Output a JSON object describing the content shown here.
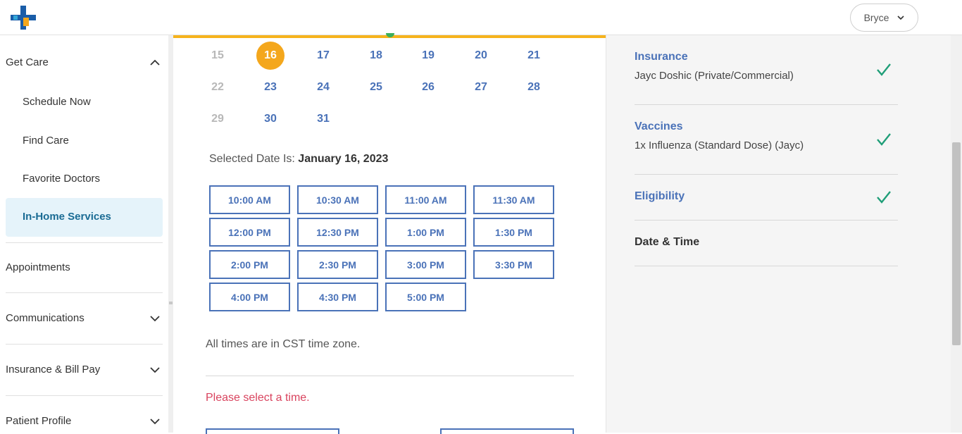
{
  "header": {
    "user_name": "Bryce",
    "icons": {
      "logo": "brand-cross-logo",
      "user_menu": "chevron-down-icon"
    }
  },
  "sidebar": {
    "get_care": "Get Care",
    "sub_items": [
      "Schedule Now",
      "Find Care",
      "Favorite Doctors"
    ],
    "active_item": "In-Home Services",
    "sections": [
      "Appointments",
      "Communications",
      "Insurance & Bill Pay",
      "Patient Profile"
    ]
  },
  "calendar": {
    "rows": [
      [
        {
          "d": "15",
          "state": "dim"
        },
        {
          "d": "16",
          "state": "selected"
        },
        {
          "d": "17",
          "state": "active"
        },
        {
          "d": "18",
          "state": "active"
        },
        {
          "d": "19",
          "state": "active"
        },
        {
          "d": "20",
          "state": "active"
        },
        {
          "d": "21",
          "state": "active"
        }
      ],
      [
        {
          "d": "22",
          "state": "dim"
        },
        {
          "d": "23",
          "state": "active"
        },
        {
          "d": "24",
          "state": "active"
        },
        {
          "d": "25",
          "state": "active"
        },
        {
          "d": "26",
          "state": "active"
        },
        {
          "d": "27",
          "state": "active"
        },
        {
          "d": "28",
          "state": "active"
        }
      ],
      [
        {
          "d": "29",
          "state": "dim"
        },
        {
          "d": "30",
          "state": "active"
        },
        {
          "d": "31",
          "state": "active"
        }
      ]
    ],
    "selected_label": "Selected Date Is:",
    "selected_value": "January 16, 2023"
  },
  "time_slots": [
    "10:00 AM",
    "10:30 AM",
    "11:00 AM",
    "11:30 AM",
    "12:00 PM",
    "12:30 PM",
    "1:00 PM",
    "1:30 PM",
    "2:00 PM",
    "2:30 PM",
    "3:00 PM",
    "3:30 PM",
    "4:00 PM",
    "4:30 PM",
    "5:00 PM"
  ],
  "timezone_note": "All times are in CST time zone.",
  "error_message": "Please select a time.",
  "summary": {
    "insurance": {
      "title": "Insurance",
      "detail": "Jayc Doshic (Private/Commercial)",
      "done": true
    },
    "vaccines": {
      "title": "Vaccines",
      "detail": "1x Influenza (Standard Dose) (Jayc)",
      "done": true
    },
    "eligibility": {
      "title": "Eligibility",
      "done": true
    },
    "datetime": {
      "title": "Date & Time",
      "done": false
    }
  },
  "colors": {
    "accent": "#4a72b8",
    "selected": "#f4a71c",
    "check": "#1f9e78",
    "error": "#d9435e",
    "active_nav_bg": "#e5f3fa"
  }
}
